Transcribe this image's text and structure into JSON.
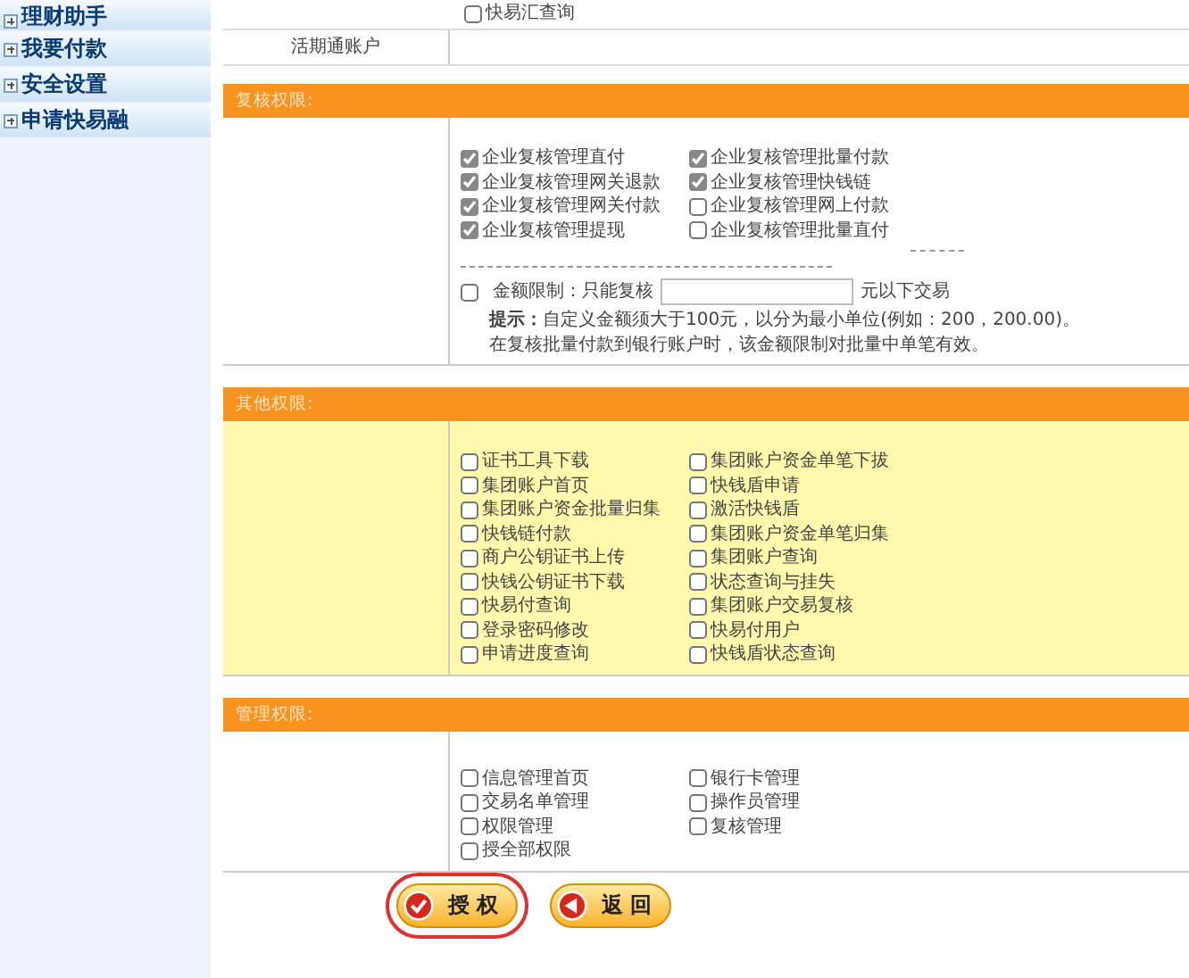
{
  "sidebar": {
    "items": [
      {
        "label": "理财助手",
        "expanded": false
      },
      {
        "label": "我要付款",
        "expanded": false
      },
      {
        "label": "安全设置",
        "expanded": false
      },
      {
        "label": "申请快易融",
        "expanded": false
      }
    ]
  },
  "top_option": {
    "label": "快易汇查询",
    "checked": false
  },
  "account_row": {
    "label": "活期通账户"
  },
  "sections": [
    {
      "title": "复核权限:",
      "tinted": false,
      "columns": [
        [
          {
            "label": "企业复核管理直付",
            "checked": true
          },
          {
            "label": "企业复核管理网关退款",
            "checked": true
          },
          {
            "label": "企业复核管理网关付款",
            "checked": true
          },
          {
            "label": "企业复核管理提现",
            "checked": true
          }
        ],
        [
          {
            "label": "企业复核管理批量付款",
            "checked": true
          },
          {
            "label": "企业复核管理快钱链",
            "checked": true
          },
          {
            "label": "企业复核管理网上付款",
            "checked": false
          },
          {
            "label": "企业复核管理批量直付",
            "checked": false
          }
        ]
      ],
      "amount_limit": {
        "checked": false,
        "label": "金额限制：只能复核",
        "suffix": "元以下交易",
        "hint": "**提示：**自定义金额须大于100元，以分为最小单位(例如：200，200.00)。",
        "note": "在复核批量付款到银行账户时，该金额限制对批量中单笔有效。"
      }
    },
    {
      "title": "其他权限:",
      "tinted": true,
      "columns": [
        [
          {
            "label": "证书工具下载",
            "checked": false
          },
          {
            "label": "集团账户首页",
            "checked": false
          },
          {
            "label": "集团账户资金批量归集",
            "checked": false
          },
          {
            "label": "快钱链付款",
            "checked": false
          },
          {
            "label": "商户公钥证书上传",
            "checked": false
          },
          {
            "label": "快钱公钥证书下载",
            "checked": false
          },
          {
            "label": "快易付查询",
            "checked": false
          },
          {
            "label": "登录密码修改",
            "checked": false
          },
          {
            "label": "申请进度查询",
            "checked": false
          }
        ],
        [
          {
            "label": "集团账户资金单笔下拔",
            "checked": false
          },
          {
            "label": "快钱盾申请",
            "checked": false
          },
          {
            "label": "激活快钱盾",
            "checked": false
          },
          {
            "label": "集团账户资金单笔归集",
            "checked": false
          },
          {
            "label": "集团账户查询",
            "checked": false
          },
          {
            "label": "状态查询与挂失",
            "checked": false
          },
          {
            "label": "集团账户交易复核",
            "checked": false
          },
          {
            "label": "快易付用户",
            "checked": false
          },
          {
            "label": "快钱盾状态查询",
            "checked": false
          }
        ]
      ]
    },
    {
      "title": "管理权限:",
      "tinted": false,
      "columns": [
        [
          {
            "label": "信息管理首页",
            "checked": false
          },
          {
            "label": "交易名单管理",
            "checked": false
          },
          {
            "label": "权限管理",
            "checked": false
          },
          {
            "label": "授全部权限",
            "checked": false
          }
        ],
        [
          {
            "label": "银行卡管理",
            "checked": false
          },
          {
            "label": "操作员管理",
            "checked": false
          },
          {
            "label": "复核管理",
            "checked": false
          }
        ]
      ]
    }
  ],
  "buttons": [
    {
      "label": "授 权",
      "kind": "confirm",
      "outlined": true
    },
    {
      "label": "返 回",
      "kind": "back",
      "outlined": false
    }
  ]
}
